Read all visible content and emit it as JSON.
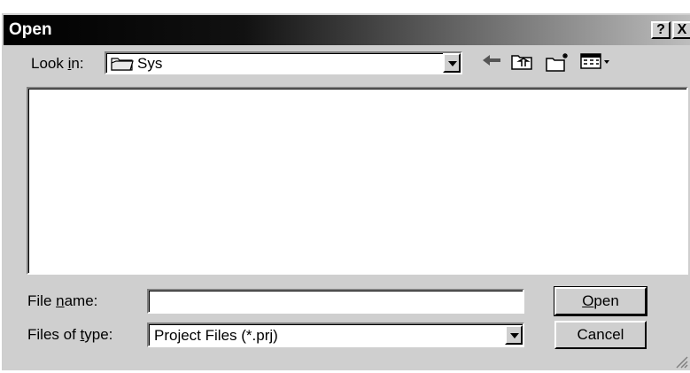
{
  "window": {
    "title": "Open",
    "help_label": "?",
    "close_label": "X"
  },
  "toolbar": {
    "look_in_label": "Look in:",
    "look_in_value": "Sys",
    "icons": [
      "back-arrow-icon",
      "up-one-level-icon",
      "new-folder-icon",
      "view-menu-icon"
    ]
  },
  "file_list": {
    "items": []
  },
  "form": {
    "file_name_label": "File name:",
    "file_name_value": "",
    "file_type_label": "Files of type:",
    "file_type_value": "Project Files (*.prj)"
  },
  "buttons": {
    "open_label": "Open",
    "cancel_label": "Cancel"
  }
}
